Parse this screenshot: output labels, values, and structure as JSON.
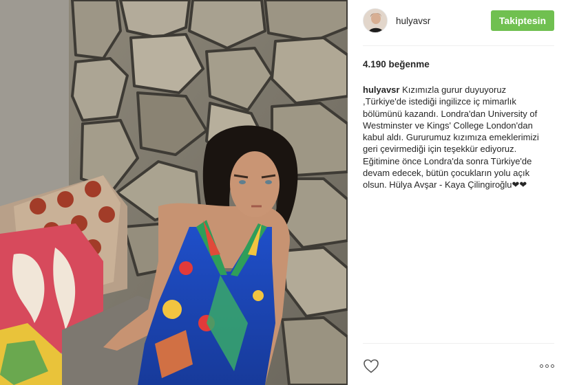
{
  "post": {
    "username": "hulyavsr",
    "follow_label": "Takiptesin",
    "likes_text": "4.190 beğenme",
    "caption_user": "hulyavsr",
    "caption_text": " Kızımızla gurur duyuyoruz ,Türkiye'de istediği ingilizce iç mimarlık bölümünü kazandı. Londra'dan University of Westminster ve Kings' College London'dan kabul aldı. Gururumuz kızımıza emeklerimizi geri çevirmediği için teşekkür ediyoruz. Eğitimine önce Londra'da sonra Türkiye'de devam edecek, bütün çocukların yolu açık olsun. Hülya Avşar - Kaya Çilingiroğlu❤❤"
  },
  "icons": {
    "avatar": "profile-avatar",
    "like": "heart-icon",
    "more": "more-options-icon"
  },
  "colors": {
    "follow_button": "#70c050",
    "text": "#262626",
    "divider": "#efefef"
  }
}
